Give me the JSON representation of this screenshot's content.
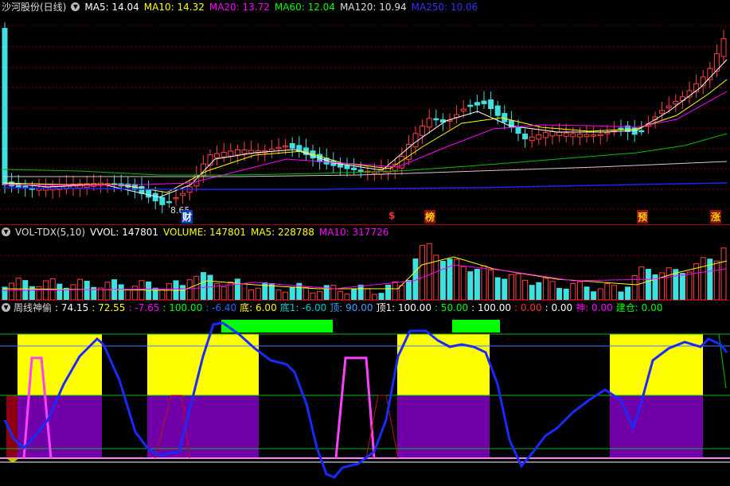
{
  "price": {
    "title": "沙河股份(日线)",
    "items": [
      {
        "label": "MA5: 14.04",
        "color": "#ffffff"
      },
      {
        "label": "MA10: 14.32",
        "color": "#ffff00"
      },
      {
        "label": "MA20: 13.72",
        "color": "#ff00ff"
      },
      {
        "label": "MA60: 12.04",
        "color": "#00ff00"
      },
      {
        "label": "MA120: 10.94",
        "color": "#dddddd"
      },
      {
        "label": "MA250: 10.06",
        "color": "#3030ff"
      }
    ],
    "low_label": "8.65",
    "markers": [
      {
        "text": "财",
        "color": "#ffffff",
        "bg": "#0040c0"
      },
      {
        "text": "$",
        "color": "#ff3030",
        "bg": "transparent"
      },
      {
        "text": "榜",
        "color": "#ffd000",
        "bg": "#8a1010"
      },
      {
        "text": "预",
        "color": "#ffd000",
        "bg": "#8a1010"
      },
      {
        "text": "涨",
        "color": "#ffd000",
        "bg": "#8a1010"
      }
    ]
  },
  "volume": {
    "title": "VOL-TDX(5,10)",
    "items": [
      {
        "label": "VVOL: 147801",
        "color": "#ffffff"
      },
      {
        "label": "VOLUME: 147801",
        "color": "#ffff00"
      },
      {
        "label": "MA5: 228788",
        "color": "#ffff00"
      },
      {
        "label": "MA10: 317726",
        "color": "#ff00ff"
      }
    ]
  },
  "indicator": {
    "title": "周线神偷",
    "items": [
      {
        "label": ": 74.15",
        "color": "#ffffff"
      },
      {
        "label": ": 72.55",
        "color": "#ffff00"
      },
      {
        "label": ": -7.65",
        "color": "#ff00ff"
      },
      {
        "label": ": 100.00",
        "color": "#00ff00"
      },
      {
        "label": ": -6.40",
        "color": "#3060ff"
      },
      {
        "label": "底: 6.00",
        "color": "#ffff00"
      },
      {
        "label": "底1: -6.00",
        "color": "#00cccc"
      },
      {
        "label": "顶: 90.00",
        "color": "#40a0ff"
      },
      {
        "label": "顶1: 100.00",
        "color": "#ffffff"
      },
      {
        "label": ": 50.00",
        "color": "#00ff00"
      },
      {
        "label": ": 100.00",
        "color": "#ffffff"
      },
      {
        "label": ": 0.00",
        "color": "#ff3030"
      },
      {
        "label": ": 0.00",
        "color": "#ffffff"
      },
      {
        "label": "神: 0.00",
        "color": "#ff00ff"
      },
      {
        "label": "建仓: 0.00",
        "color": "#00ff00"
      }
    ]
  }
}
